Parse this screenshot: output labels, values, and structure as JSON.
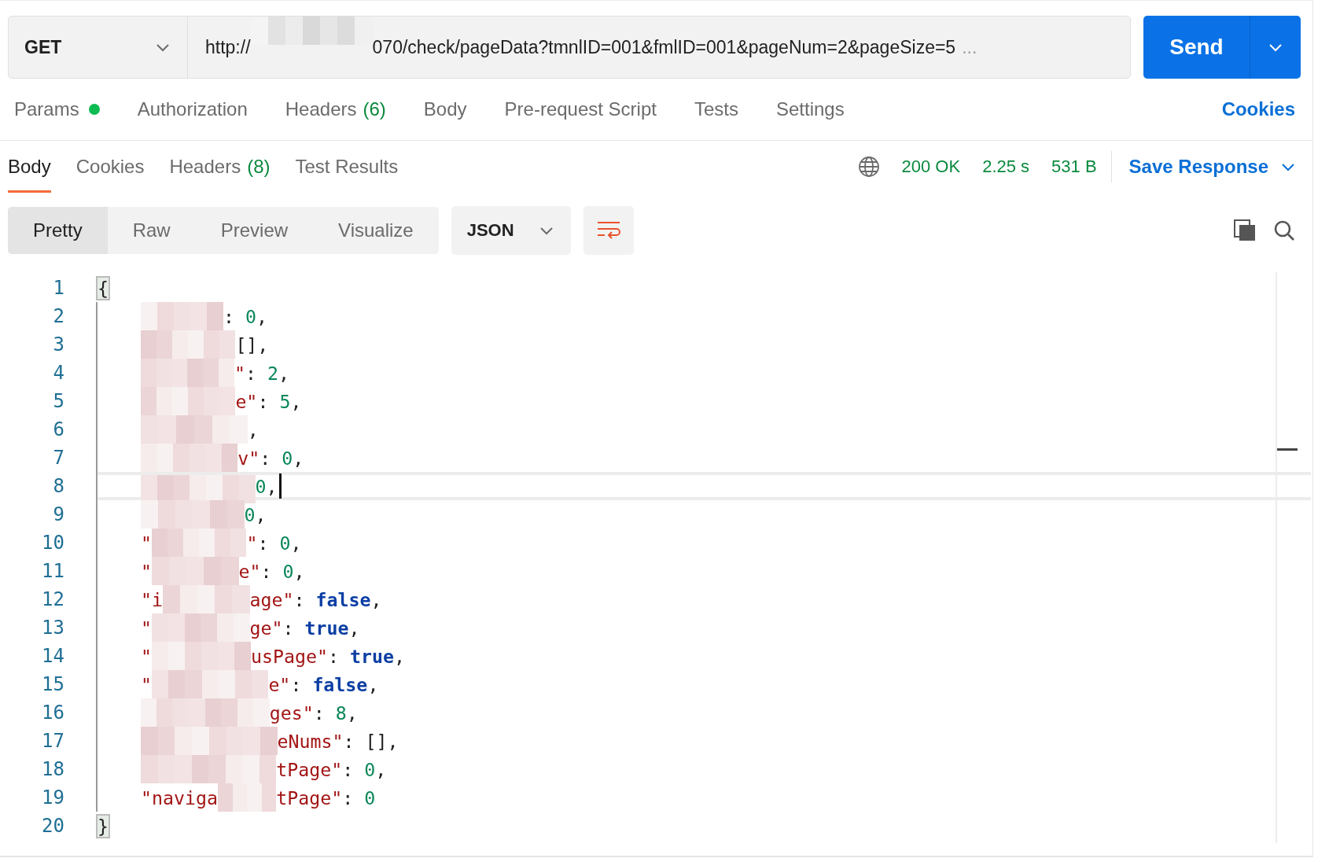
{
  "request": {
    "method": "GET",
    "url_start": "http://",
    "url_end": "070/check/pageData?tmnlID=001&fmlID=001&pageNum=2&pageSize=5",
    "url_more": "...",
    "send": "Send"
  },
  "request_tabs": [
    {
      "label": "Params",
      "indicator": true
    },
    {
      "label": "Authorization",
      "indicator": false
    },
    {
      "label": "Headers",
      "count": "(6)",
      "indicator": false
    },
    {
      "label": "Body",
      "indicator": false
    },
    {
      "label": "Pre-request Script",
      "indicator": false
    },
    {
      "label": "Tests",
      "indicator": false
    },
    {
      "label": "Settings",
      "indicator": false
    }
  ],
  "cookies_link": "Cookies",
  "response_tabs": [
    {
      "label": "Body",
      "selected": true
    },
    {
      "label": "Cookies",
      "selected": false
    },
    {
      "label": "Headers",
      "count": "(8)",
      "selected": false
    },
    {
      "label": "Test Results",
      "selected": false
    }
  ],
  "status": {
    "code": "200 OK",
    "time": "2.25 s",
    "size": "531 B"
  },
  "save_response": "Save Response",
  "view_modes": [
    {
      "label": "Pretty",
      "selected": true
    },
    {
      "label": "Raw",
      "selected": false
    },
    {
      "label": "Preview",
      "selected": false
    },
    {
      "label": "Visualize",
      "selected": false
    }
  ],
  "format": "JSON",
  "editor": {
    "lines": [
      {
        "number": "1",
        "lead": [
          {
            "kind": "punct",
            "s": "{"
          }
        ],
        "bracket_match": true,
        "active": false
      },
      {
        "number": "2",
        "tail": [
          {
            "kind": "punct",
            "s": ": "
          },
          {
            "kind": "num",
            "s": "0"
          },
          {
            "kind": "punct",
            "s": ","
          }
        ],
        "bracket_match": false,
        "active": false
      },
      {
        "number": "3",
        "tail": [
          {
            "kind": "punct",
            "s": "[],"
          }
        ],
        "bracket_match": false,
        "active": false
      },
      {
        "number": "4",
        "tail": [
          {
            "kind": "key",
            "s": "\""
          },
          {
            "kind": "punct",
            "s": ": "
          },
          {
            "kind": "num",
            "s": "2"
          },
          {
            "kind": "punct",
            "s": ","
          }
        ],
        "bracket_match": false,
        "active": false
      },
      {
        "number": "5",
        "tail": [
          {
            "kind": "key",
            "s": "e\""
          },
          {
            "kind": "punct",
            "s": ": "
          },
          {
            "kind": "num",
            "s": "5"
          },
          {
            "kind": "punct",
            "s": ","
          }
        ],
        "bracket_match": false,
        "active": false
      },
      {
        "number": "6",
        "tail": [
          {
            "kind": "punct",
            "s": ","
          }
        ],
        "bracket_match": false,
        "active": false
      },
      {
        "number": "7",
        "tail": [
          {
            "kind": "key",
            "s": "v\""
          },
          {
            "kind": "punct",
            "s": ": "
          },
          {
            "kind": "num",
            "s": "0"
          },
          {
            "kind": "punct",
            "s": ","
          }
        ],
        "bracket_match": false,
        "active": false
      },
      {
        "number": "8",
        "tail": [
          {
            "kind": "num",
            "s": "0"
          },
          {
            "kind": "punct",
            "s": ","
          }
        ],
        "bracket_match": false,
        "active": true
      },
      {
        "number": "9",
        "tail": [
          {
            "kind": "num",
            "s": "0"
          },
          {
            "kind": "punct",
            "s": ","
          }
        ],
        "bracket_match": false,
        "active": false
      },
      {
        "number": "10",
        "lead": [
          {
            "kind": "key",
            "s": "\""
          }
        ],
        "tail": [
          {
            "kind": "key",
            "s": "\""
          },
          {
            "kind": "punct",
            "s": ": "
          },
          {
            "kind": "num",
            "s": "0"
          },
          {
            "kind": "punct",
            "s": ","
          }
        ],
        "bracket_match": false,
        "active": false
      },
      {
        "number": "11",
        "lead": [
          {
            "kind": "key",
            "s": "\""
          }
        ],
        "tail": [
          {
            "kind": "key",
            "s": "e\""
          },
          {
            "kind": "punct",
            "s": ": "
          },
          {
            "kind": "num",
            "s": "0"
          },
          {
            "kind": "punct",
            "s": ","
          }
        ],
        "bracket_match": false,
        "active": false
      },
      {
        "number": "12",
        "lead": [
          {
            "kind": "key",
            "s": "\"i"
          }
        ],
        "tail": [
          {
            "kind": "key",
            "s": "age\""
          },
          {
            "kind": "punct",
            "s": ": "
          },
          {
            "kind": "bool",
            "s": "false"
          },
          {
            "kind": "punct",
            "s": ","
          }
        ],
        "bracket_match": false,
        "active": false
      },
      {
        "number": "13",
        "lead": [
          {
            "kind": "key",
            "s": "\""
          }
        ],
        "tail": [
          {
            "kind": "key",
            "s": "ge\""
          },
          {
            "kind": "punct",
            "s": ": "
          },
          {
            "kind": "bool",
            "s": "true"
          },
          {
            "kind": "punct",
            "s": ","
          }
        ],
        "bracket_match": false,
        "active": false
      },
      {
        "number": "14",
        "lead": [
          {
            "kind": "key",
            "s": "\""
          }
        ],
        "tail": [
          {
            "kind": "key",
            "s": "usPage\""
          },
          {
            "kind": "punct",
            "s": ": "
          },
          {
            "kind": "bool",
            "s": "true"
          },
          {
            "kind": "punct",
            "s": ","
          }
        ],
        "bracket_match": false,
        "active": false
      },
      {
        "number": "15",
        "lead": [
          {
            "kind": "key",
            "s": "\""
          }
        ],
        "tail": [
          {
            "kind": "key",
            "s": "e\""
          },
          {
            "kind": "punct",
            "s": ": "
          },
          {
            "kind": "bool",
            "s": "false"
          },
          {
            "kind": "punct",
            "s": ","
          }
        ],
        "bracket_match": false,
        "active": false
      },
      {
        "number": "16",
        "tail": [
          {
            "kind": "key",
            "s": "ges\""
          },
          {
            "kind": "punct",
            "s": ": "
          },
          {
            "kind": "num",
            "s": "8"
          },
          {
            "kind": "punct",
            "s": ","
          }
        ],
        "bracket_match": false,
        "active": false
      },
      {
        "number": "17",
        "tail": [
          {
            "kind": "key",
            "s": "eNums\""
          },
          {
            "kind": "punct",
            "s": ": [],"
          }
        ],
        "bracket_match": false,
        "active": false
      },
      {
        "number": "18",
        "tail": [
          {
            "kind": "key",
            "s": "tPage\""
          },
          {
            "kind": "punct",
            "s": ": "
          },
          {
            "kind": "num",
            "s": "0"
          },
          {
            "kind": "punct",
            "s": ","
          }
        ],
        "bracket_match": false,
        "active": false
      },
      {
        "number": "19",
        "lead": [
          {
            "kind": "key",
            "s": "\"naviga"
          }
        ],
        "tail": [
          {
            "kind": "key",
            "s": "tPage\""
          },
          {
            "kind": "punct",
            "s": ": "
          },
          {
            "kind": "num",
            "s": "0"
          }
        ],
        "bracket_match": false,
        "active": false
      },
      {
        "number": "20",
        "lead": [
          {
            "kind": "punct",
            "s": "}"
          }
        ],
        "bracket_match": true,
        "active": false
      }
    ]
  }
}
